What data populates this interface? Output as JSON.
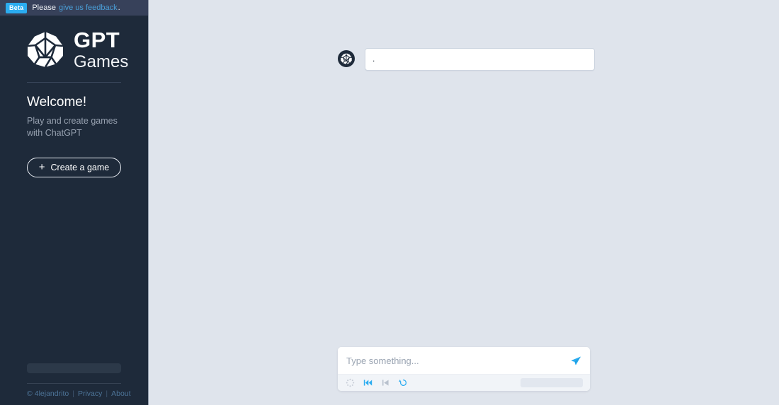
{
  "banner": {
    "badge": "Beta",
    "prefix": "Please",
    "link": "give us feedback",
    "suffix": ".",
    "badge_color": "#2bacf0",
    "link_color": "#4a9fd8"
  },
  "brand": {
    "icon": "d20-die-icon",
    "name_line1": "GPT",
    "name_line2": "Games"
  },
  "sidebar": {
    "welcome_title": "Welcome!",
    "welcome_subtitle": "Play and create games with ChatGPT",
    "create_button": {
      "plus": "+",
      "label": "Create a game"
    },
    "skeleton_placeholder": "",
    "footer": {
      "copyright_symbol": "©",
      "author": "4lejandrito",
      "separator": "|",
      "privacy": "Privacy",
      "about": "About"
    },
    "background_color": "#1e2a3a"
  },
  "chat": {
    "messages": [
      {
        "author_icon": "d20-die-avatar-icon",
        "text": "."
      }
    ]
  },
  "composer": {
    "placeholder": "Type something...",
    "value": "",
    "send_icon": "send-paper-plane-icon",
    "toolbar": [
      {
        "icon": "loading-spinner-icon",
        "label": "loading",
        "color": "#c6ccd6"
      },
      {
        "icon": "skip-to-start-icon",
        "label": "restart",
        "color": "#2bacf0"
      },
      {
        "icon": "step-back-icon",
        "label": "step back",
        "color": "#b9c2ce"
      },
      {
        "icon": "reset-undo-icon",
        "label": "reset",
        "color": "#2bacf0"
      }
    ],
    "skeleton_placeholder": ""
  },
  "theme": {
    "main_background": "#dfe4ec",
    "accent": "#2bacf0"
  }
}
